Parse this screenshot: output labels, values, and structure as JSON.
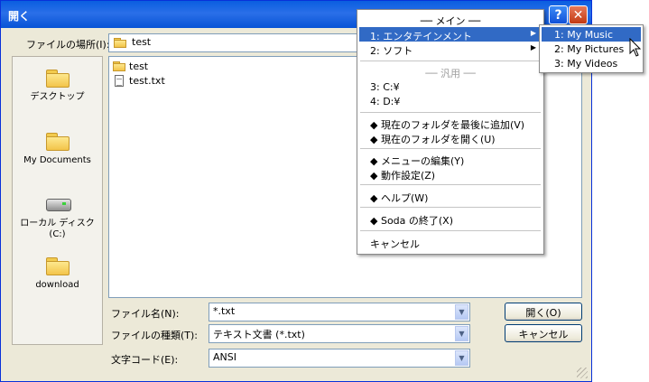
{
  "window": {
    "title": "開く"
  },
  "titlebar": {
    "help_glyph": "?",
    "close_glyph": "✕"
  },
  "location": {
    "label": "ファイルの場所(I):",
    "value": "test"
  },
  "places": [
    {
      "label": "デスクトップ",
      "icon": "folder-icon"
    },
    {
      "label": "My Documents",
      "icon": "folder-icon"
    },
    {
      "label": "ローカル ディスク (C:)",
      "icon": "disk-icon"
    },
    {
      "label": "download",
      "icon": "folder-icon"
    }
  ],
  "files": [
    {
      "name": "test",
      "icon": "folder-icon"
    },
    {
      "name": "test.txt",
      "icon": "text-file-icon"
    }
  ],
  "form": {
    "filename_label": "ファイル名(N):",
    "filename_value": "*.txt",
    "filetype_label": "ファイルの種類(T):",
    "filetype_value": "テキスト文書 (*.txt)",
    "encoding_label": "文字コード(E):",
    "encoding_value": "ANSI"
  },
  "buttons": {
    "open": "開く(O)",
    "cancel": "キャンセル"
  },
  "context_menu": {
    "header_main": "── メイン ──",
    "item_entertainment": "1: エンタテインメント",
    "item_soft": "2: ソフト",
    "header_general": "── 汎用 ──",
    "item_c": "3: C:¥",
    "item_d": "4: D:¥",
    "item_add_last": "◆ 現在のフォルダを最後に追加(V)",
    "item_open_current": "◆ 現在のフォルダを開く(U)",
    "item_edit_menu": "◆ メニューの編集(Y)",
    "item_settings": "◆ 動作設定(Z)",
    "item_help": "◆ ヘルプ(W)",
    "item_exit": "◆ Soda の終了(X)",
    "item_cancel": "キャンセル"
  },
  "submenu": {
    "item_music": "1: My Music",
    "item_pictures": "2: My Pictures",
    "item_videos": "3: My Videos"
  },
  "colors": {
    "highlight": "#316ac5",
    "titlebar": "#0a5ee0"
  }
}
